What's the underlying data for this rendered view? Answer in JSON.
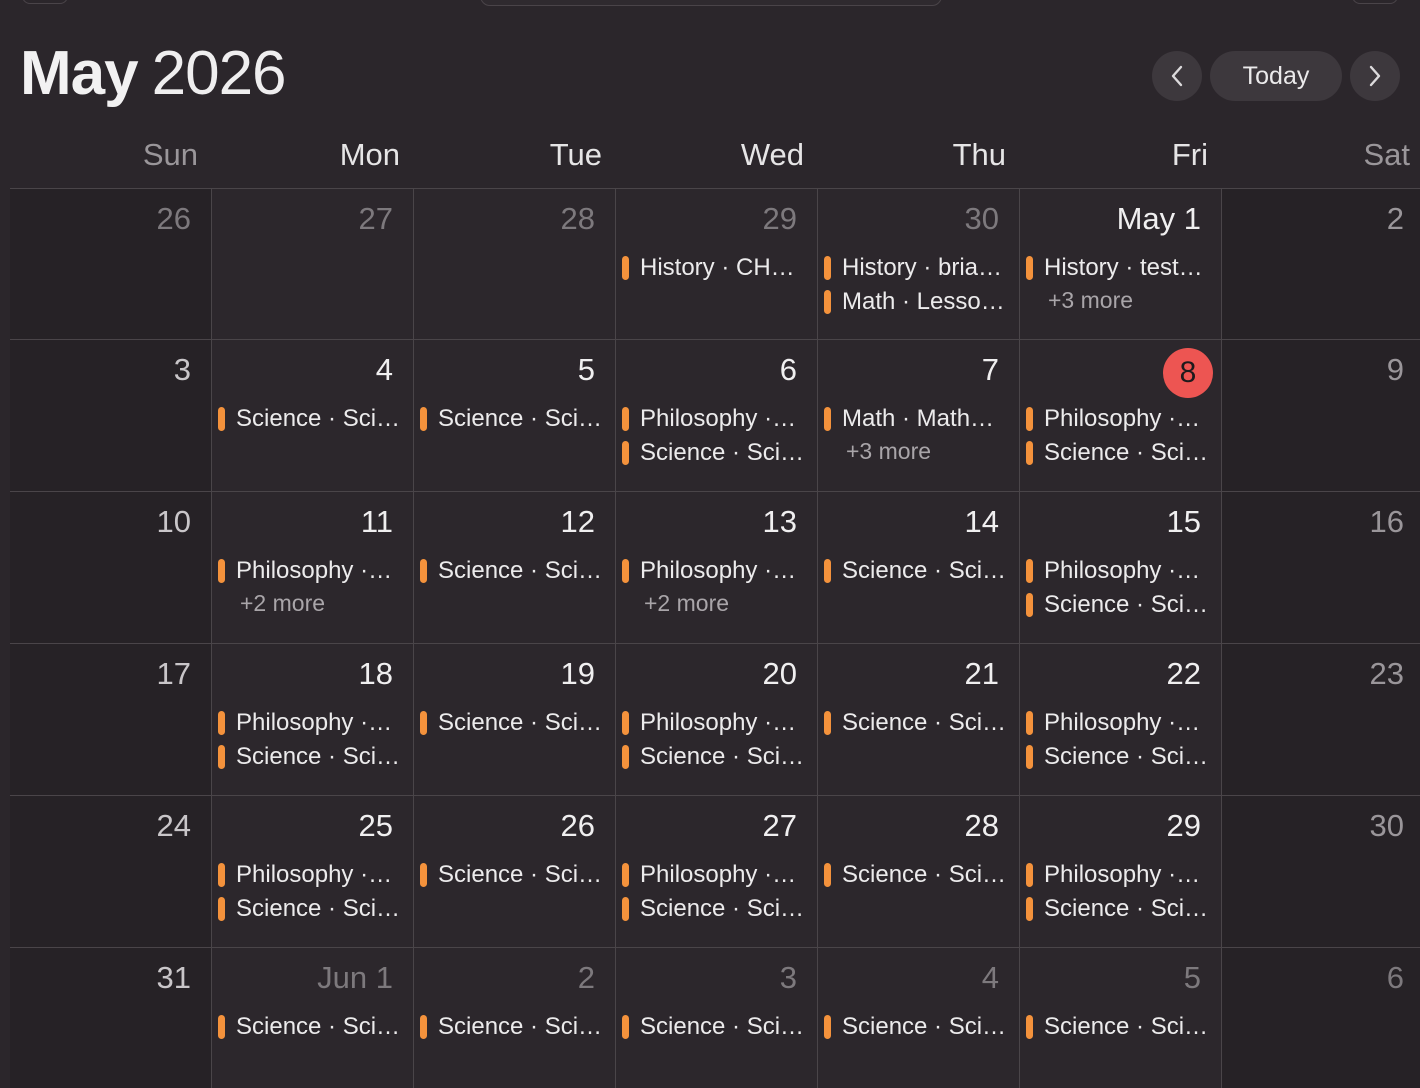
{
  "header": {
    "month": "May",
    "year": "2026",
    "today_label": "Today",
    "prev_icon": "chevron-left-icon",
    "next_icon": "chevron-right-icon"
  },
  "weekdays": [
    "Sun",
    "Mon",
    "Tue",
    "Wed",
    "Thu",
    "Fri",
    "Sat"
  ],
  "colors": {
    "event_accent": "#f4923c",
    "today_badge": "#ed5552",
    "background": "#2b262b"
  },
  "weeks": [
    [
      {
        "day": "26",
        "other": true,
        "events": [],
        "more": ""
      },
      {
        "day": "27",
        "other": true,
        "events": [],
        "more": ""
      },
      {
        "day": "28",
        "other": true,
        "events": [],
        "more": ""
      },
      {
        "day": "29",
        "other": true,
        "events": [
          "History · CH…"
        ],
        "more": ""
      },
      {
        "day": "30",
        "other": true,
        "events": [
          "History · bria…",
          "Math · Lesso…"
        ],
        "more": ""
      },
      {
        "day": "May 1",
        "other": false,
        "events": [
          "History · test…"
        ],
        "more": "+3 more"
      },
      {
        "day": "2",
        "other": false,
        "events": [],
        "more": ""
      }
    ],
    [
      {
        "day": "3",
        "other": false,
        "events": [],
        "more": ""
      },
      {
        "day": "4",
        "other": false,
        "events": [
          "Science · Sci…"
        ],
        "more": ""
      },
      {
        "day": "5",
        "other": false,
        "events": [
          "Science · Sci…"
        ],
        "more": ""
      },
      {
        "day": "6",
        "other": false,
        "events": [
          "Philosophy ·…",
          "Science · Sci…"
        ],
        "more": ""
      },
      {
        "day": "7",
        "other": false,
        "events": [
          "Math · Math…"
        ],
        "more": "+3 more"
      },
      {
        "day": "8",
        "other": false,
        "today": true,
        "events": [
          "Philosophy ·…",
          "Science · Sci…"
        ],
        "more": ""
      },
      {
        "day": "9",
        "other": false,
        "events": [],
        "more": ""
      }
    ],
    [
      {
        "day": "10",
        "other": false,
        "events": [],
        "more": ""
      },
      {
        "day": "11",
        "other": false,
        "events": [
          "Philosophy ·…"
        ],
        "more": "+2 more"
      },
      {
        "day": "12",
        "other": false,
        "events": [
          "Science · Sci…"
        ],
        "more": ""
      },
      {
        "day": "13",
        "other": false,
        "events": [
          "Philosophy ·…"
        ],
        "more": "+2 more"
      },
      {
        "day": "14",
        "other": false,
        "events": [
          "Science · Sci…"
        ],
        "more": ""
      },
      {
        "day": "15",
        "other": false,
        "events": [
          "Philosophy ·…",
          "Science · Sci…"
        ],
        "more": ""
      },
      {
        "day": "16",
        "other": false,
        "events": [],
        "more": ""
      }
    ],
    [
      {
        "day": "17",
        "other": false,
        "events": [],
        "more": ""
      },
      {
        "day": "18",
        "other": false,
        "events": [
          "Philosophy ·…",
          "Science · Sci…"
        ],
        "more": ""
      },
      {
        "day": "19",
        "other": false,
        "events": [
          "Science · Sci…"
        ],
        "more": ""
      },
      {
        "day": "20",
        "other": false,
        "events": [
          "Philosophy ·…",
          "Science · Sci…"
        ],
        "more": ""
      },
      {
        "day": "21",
        "other": false,
        "events": [
          "Science · Sci…"
        ],
        "more": ""
      },
      {
        "day": "22",
        "other": false,
        "events": [
          "Philosophy ·…",
          "Science · Sci…"
        ],
        "more": ""
      },
      {
        "day": "23",
        "other": false,
        "events": [],
        "more": ""
      }
    ],
    [
      {
        "day": "24",
        "other": false,
        "events": [],
        "more": ""
      },
      {
        "day": "25",
        "other": false,
        "events": [
          "Philosophy ·…",
          "Science · Sci…"
        ],
        "more": ""
      },
      {
        "day": "26",
        "other": false,
        "events": [
          "Science · Sci…"
        ],
        "more": ""
      },
      {
        "day": "27",
        "other": false,
        "events": [
          "Philosophy ·…",
          "Science · Sci…"
        ],
        "more": ""
      },
      {
        "day": "28",
        "other": false,
        "events": [
          "Science · Sci…"
        ],
        "more": ""
      },
      {
        "day": "29",
        "other": false,
        "events": [
          "Philosophy ·…",
          "Science · Sci…"
        ],
        "more": ""
      },
      {
        "day": "30",
        "other": false,
        "events": [],
        "more": ""
      }
    ],
    [
      {
        "day": "31",
        "other": false,
        "events": [],
        "more": ""
      },
      {
        "day": "Jun 1",
        "other": true,
        "events": [
          "Science · Sci…"
        ],
        "more": ""
      },
      {
        "day": "2",
        "other": true,
        "events": [
          "Science · Sci…"
        ],
        "more": ""
      },
      {
        "day": "3",
        "other": true,
        "events": [
          "Science · Sci…"
        ],
        "more": ""
      },
      {
        "day": "4",
        "other": true,
        "events": [
          "Science · Sci…"
        ],
        "more": ""
      },
      {
        "day": "5",
        "other": true,
        "events": [
          "Science · Sci…"
        ],
        "more": ""
      },
      {
        "day": "6",
        "other": true,
        "events": [],
        "more": ""
      }
    ]
  ]
}
